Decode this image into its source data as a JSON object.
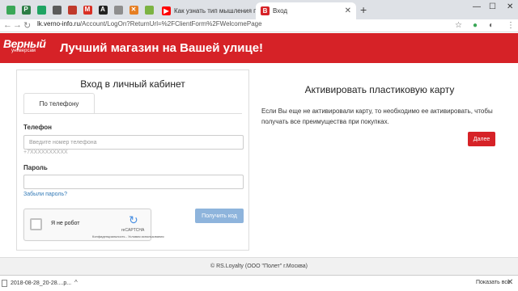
{
  "browser": {
    "pinned_tabs": [
      {
        "icon": "green-doc-icon",
        "glyph": "",
        "color": "#3aa757"
      },
      {
        "icon": "parking-icon",
        "glyph": "P",
        "color": "#2d7d46"
      },
      {
        "icon": "green-square-icon",
        "glyph": "",
        "color": "#1fa463"
      },
      {
        "icon": "brain-icon",
        "glyph": "",
        "color": "#5b5b5b"
      },
      {
        "icon": "red-box-icon",
        "glyph": "",
        "color": "#c0392b"
      },
      {
        "icon": "gmail-icon",
        "glyph": "M",
        "color": "#d93025"
      },
      {
        "icon": "letter-a-icon",
        "glyph": "A",
        "color": "#222222"
      },
      {
        "icon": "image-icon",
        "glyph": "",
        "color": "#8e8e8e"
      },
      {
        "icon": "x-icon",
        "glyph": "✕",
        "color": "#e67e22"
      },
      {
        "icon": "puzzle-icon",
        "glyph": "",
        "color": "#7cb342"
      }
    ],
    "tabs": [
      {
        "title": "Как узнать тип мышления по л",
        "favicon_color": "#ff0000"
      },
      {
        "title": "Вход",
        "favicon_color": "#d62227",
        "favicon_glyph": "В"
      }
    ],
    "window_controls": {
      "minimize": "—",
      "maximize": "☐",
      "close": "✕"
    },
    "url": {
      "host": "lk.verno-info.ru",
      "path": "/Account/LogOn?ReturnUrl=%2FClientForm%2FWelcomePage"
    }
  },
  "header": {
    "logo_main": "Верный",
    "logo_sub": "универсам",
    "slogan": "Лучший магазин на Вашей улице!",
    "brand_color": "#d62227"
  },
  "login": {
    "title": "Вход в личный кабинет",
    "tab_phone": "По телефону",
    "phone_label": "Телефон",
    "phone_placeholder": "Введите номер телефона",
    "phone_hint": "+7XXXXXXXXXX",
    "password_label": "Пароль",
    "password_value": "",
    "forgot_link": "Забыли пароль?",
    "get_code_button": "Получить код"
  },
  "captcha": {
    "label": "Я не робот",
    "brand": "reCAPTCHA",
    "terms": "Конфиденциальность - Условия использования"
  },
  "activate": {
    "title": "Активировать пластиковую карту",
    "text": "Если Вы еще не активировали карту, то необходимо ее активировать, чтобы получать все преимущества при покупках.",
    "button": "Далее"
  },
  "footer": {
    "text": "© RS.Loyalty (ООО \"Полет\" г.Москва)"
  },
  "downloads": {
    "file_name": "2018-08-28_20-28....p...",
    "show_all": "Показать все"
  }
}
